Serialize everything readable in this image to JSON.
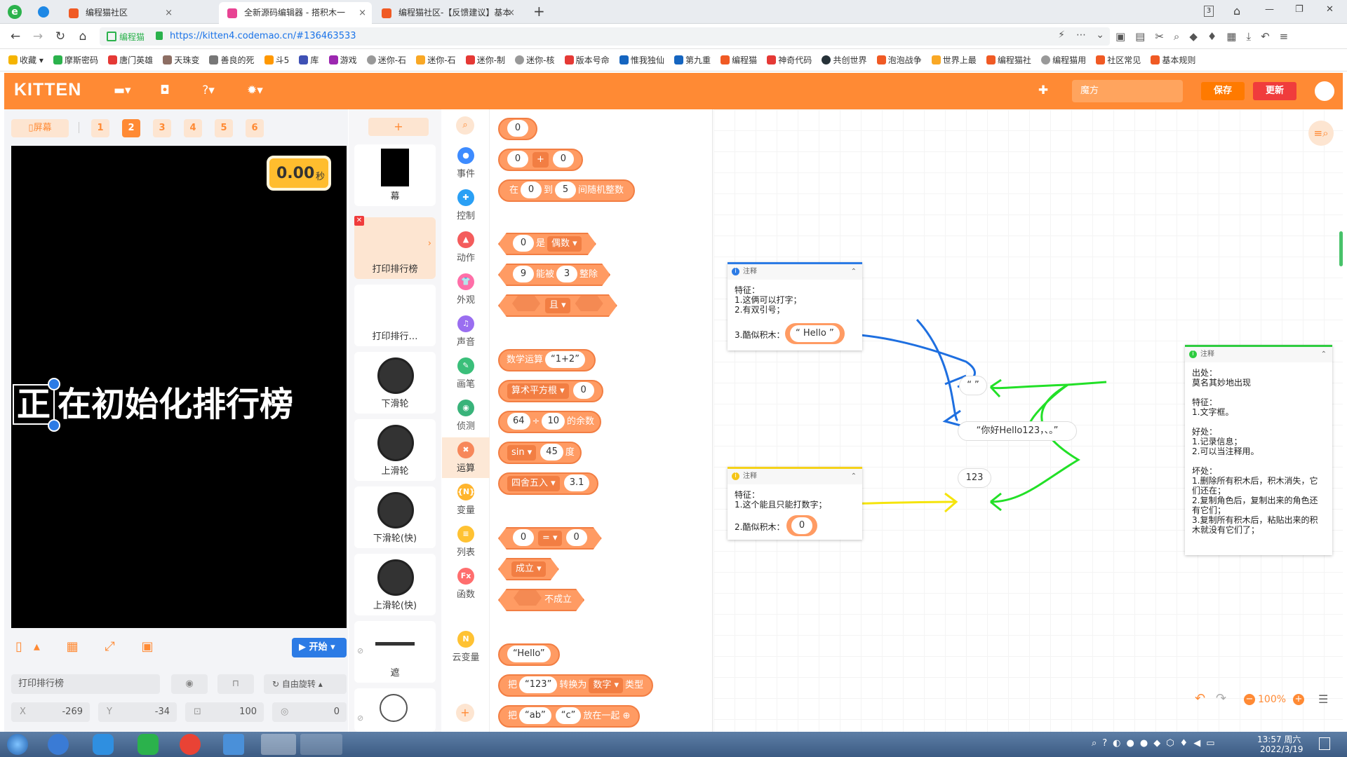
{
  "browser": {
    "tabs": [
      {
        "title": "编程猫社区",
        "close": "×"
      },
      {
        "title": "全新源码编辑器 - 搭积木一",
        "close": "×"
      },
      {
        "title": "编程猫社区-【反馈建议】基本",
        "close": "×"
      },
      {
        "title": "+",
        "close": ""
      }
    ],
    "window_controls": {
      "badge": "3",
      "min": "—",
      "restore": "❐",
      "close": "✕"
    },
    "site_name": "编程猫",
    "url": "https://kitten4.codemao.cn/#136463533",
    "bookmarks": [
      "收藏",
      "摩斯密码",
      "唐门英雄",
      "天珠变",
      "善良的死",
      "斗5",
      "库",
      "游戏",
      "迷你-石",
      "迷你-石",
      "迷你-制",
      "迷你-核",
      "版本号命",
      "惟我独仙",
      "第九重",
      "编程猫",
      "神奇代码",
      "共创世界",
      "泡泡战争",
      "世界上最",
      "编程猫社",
      "编程猫用",
      "社区常见",
      "基本规则"
    ]
  },
  "app": {
    "logo": "KITTEN",
    "user_field": "魔方",
    "save": "保存",
    "update": "更新"
  },
  "stage": {
    "screen_btn": "屏幕",
    "pages": [
      "1",
      "2",
      "3",
      "4",
      "5",
      "6"
    ],
    "active_page": "2",
    "timer": "0.00",
    "timer_unit": "秒",
    "text_box": "正",
    "text_rest": "在初始化排行榜",
    "start": "开始",
    "sprite_name": "打印排行榜",
    "rotate": "自由旋转",
    "x_label": "X",
    "x": "-269",
    "y_label": "Y",
    "y": "-34",
    "size": "100",
    "direction": "0"
  },
  "sprites": {
    "add": "+",
    "items": [
      "幕",
      "打印排行榜",
      "打印排行…",
      "下滑轮",
      "上滑轮",
      "下滑轮(快)",
      "上滑轮(快)",
      "遮",
      ""
    ]
  },
  "categories": [
    "事件",
    "控制",
    "动作",
    "外观",
    "声音",
    "画笔",
    "侦测",
    "运算",
    "变量",
    "列表",
    "函数",
    "云变量"
  ],
  "cat_colors": [
    "#3d8bff",
    "#2aa0f5",
    "#f45c5c",
    "#ff6fa8",
    "#9a6ef0",
    "#3abf7a",
    "#39b37a",
    "#f7875a",
    "#ffb52e",
    "#ffc233",
    "#ff6e6e",
    "#ffc233"
  ],
  "cat_icons": [
    "●",
    "✚",
    "▲",
    "👕",
    "♫",
    "✎",
    "◉",
    "✖",
    "{N}",
    "≡",
    "Fx",
    "N"
  ],
  "blocks": {
    "zero": "0",
    "plus": "+",
    "rand_at": "在",
    "rand_to": "到",
    "rand_from": "0",
    "rand_end": "5",
    "rand_label": "间随机整数",
    "is": "是",
    "even": "偶数",
    "nine": "9",
    "divisible": "能被",
    "three": "3",
    "exact": "整除",
    "and": "且",
    "math_op": "数学运算",
    "math_val": "1+2",
    "sqrt": "算术平方根",
    "mod_a": "64",
    "div": "÷",
    "mod_b": "10",
    "mod_label": "的余数",
    "sin": "sin",
    "sin_val": "45",
    "deg": "度",
    "round": "四舍五入",
    "round_val": "3.1",
    "eq": "=",
    "true": "成立",
    "false": "不成立",
    "hello": "Hello",
    "convert_pre": "把",
    "convert_val": "123",
    "convert_to": "转换为",
    "convert_type": "数字",
    "convert_suffix": "类型",
    "join_pre": "把",
    "join_a": "ab",
    "join_b": "c",
    "join_label": "放在一起"
  },
  "notes": [
    {
      "header": "注释",
      "body": "特征：\n1.这俩可以打字；\n2.有双引号；",
      "tail_label": "3.酷似积木：",
      "tail_val": "Hello",
      "color": "#2c7be5"
    },
    {
      "header": "注释",
      "body": "特征：\n1.这个能且只能打数字；",
      "tail_label": "2.酷似积木：",
      "tail_val": "0",
      "color": "#f5d21a"
    },
    {
      "header": "注释",
      "body": "出处：\n莫名其妙地出现\n\n特征：\n1.文字框。\n\n好处：\n1.记录信息；\n2.可以当注释用。\n\n坏处：\n1.删除所有积木后，积木消失，它们还在；\n2.复制角色后，复制出来的角色还有它们；\n3.复制所有积木后，粘贴出来的积木就没有它们了；",
      "color": "#2ecc40"
    }
  ],
  "ws_blocks": {
    "quote": "“ ”",
    "text": "“你好Hello123，、。”",
    "num": "123"
  },
  "zoom": "100%",
  "taskbar": {
    "time": "13:57 周六",
    "date": "2022/3/19"
  }
}
